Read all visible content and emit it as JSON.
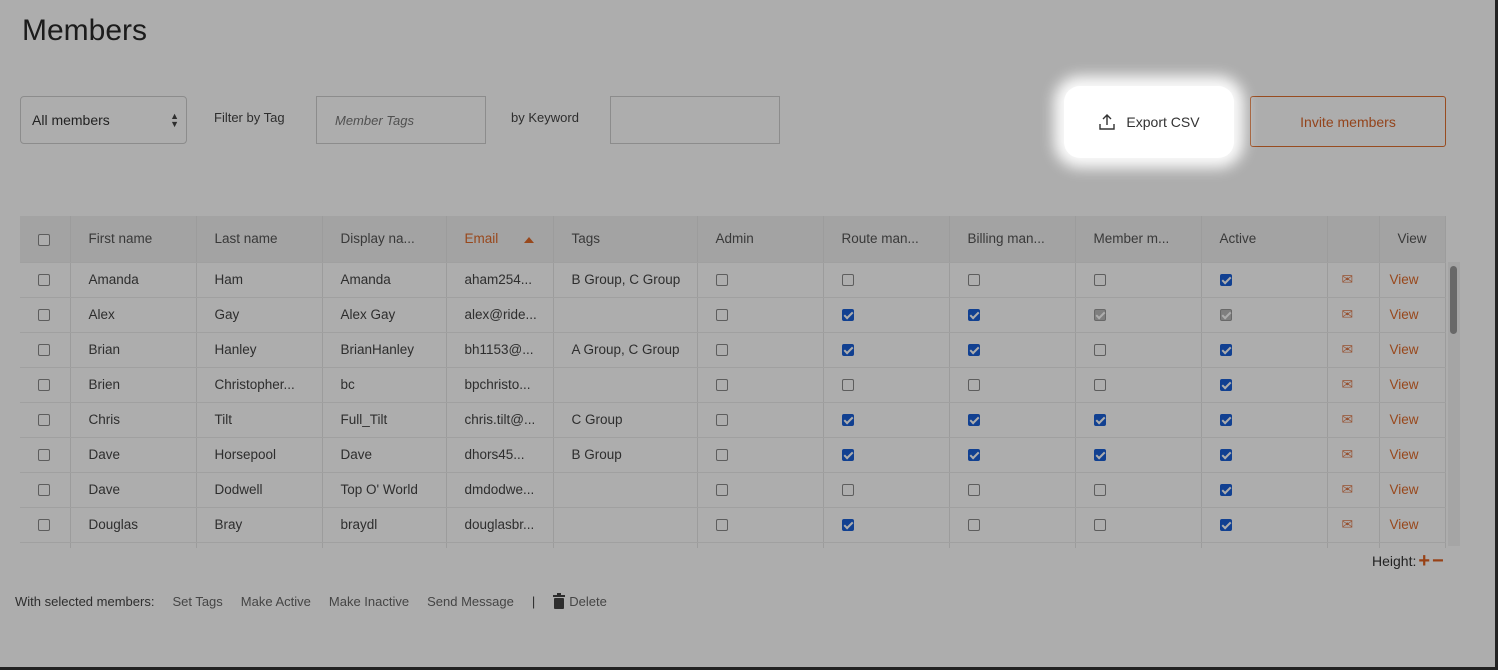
{
  "page": {
    "title": "Members"
  },
  "filters": {
    "member_select": "All members",
    "tag_label": "Filter by Tag",
    "tag_placeholder": "Member Tags",
    "keyword_label": "by Keyword",
    "keyword_value": ""
  },
  "actions": {
    "export_label": "Export CSV",
    "invite_label": "Invite members"
  },
  "table": {
    "headers": {
      "first": "First name",
      "last": "Last name",
      "display": "Display na...",
      "email": "Email",
      "tags": "Tags",
      "admin": "Admin",
      "route": "Route man...",
      "billing": "Billing man...",
      "member": "Member m...",
      "active": "Active",
      "view": "View"
    },
    "view_label": "View",
    "rows": [
      {
        "first": "Amanda",
        "last": "Ham",
        "display": "Amanda",
        "email": "aham254...",
        "tags": "B Group, C Group",
        "admin": "off",
        "route": "off",
        "billing": "off",
        "member": "off",
        "active": "on"
      },
      {
        "first": "Alex",
        "last": "Gay",
        "display": "Alex Gay",
        "email": "alex@ride...",
        "tags": "",
        "admin": "off",
        "route": "on",
        "billing": "on",
        "member": "disabled",
        "active": "disabled"
      },
      {
        "first": "Brian",
        "last": "Hanley",
        "display": "BrianHanley",
        "email": "bh1153@...",
        "tags": "A Group, C Group",
        "admin": "off",
        "route": "on",
        "billing": "on",
        "member": "off",
        "active": "on"
      },
      {
        "first": "Brien",
        "last": "Christopher...",
        "display": "bc",
        "email": "bpchristo...",
        "tags": "",
        "admin": "off",
        "route": "off",
        "billing": "off",
        "member": "off",
        "active": "on"
      },
      {
        "first": "Chris",
        "last": "Tilt",
        "display": "Full_Tilt",
        "email": "chris.tilt@...",
        "tags": "C Group",
        "admin": "off",
        "route": "on",
        "billing": "on",
        "member": "on",
        "active": "on"
      },
      {
        "first": "Dave",
        "last": "Horsepool",
        "display": "Dave",
        "email": "dhors45...",
        "tags": "B Group",
        "admin": "off",
        "route": "on",
        "billing": "on",
        "member": "on",
        "active": "on"
      },
      {
        "first": "Dave",
        "last": "Dodwell",
        "display": "Top O' World",
        "email": "dmdodwe...",
        "tags": "",
        "admin": "off",
        "route": "off",
        "billing": "off",
        "member": "off",
        "active": "on"
      },
      {
        "first": "Douglas",
        "last": "Bray",
        "display": "braydl",
        "email": "douglasbr...",
        "tags": "",
        "admin": "off",
        "route": "on",
        "billing": "off",
        "member": "off",
        "active": "on"
      },
      {
        "first": "",
        "last": "",
        "display": "",
        "email": "",
        "tags": "",
        "admin": "none",
        "route": "none",
        "billing": "none",
        "member": "none",
        "active": "none"
      }
    ]
  },
  "height_control": {
    "label": "Height:",
    "plus": "+",
    "minus": "−"
  },
  "bulk": {
    "label": "With selected members:",
    "set_tags": "Set Tags",
    "make_active": "Make Active",
    "make_inactive": "Make Inactive",
    "send_message": "Send Message",
    "separator": "|",
    "delete": "Delete"
  },
  "colors": {
    "accent": "#e06a2a",
    "checkbox_on": "#1a5fd6"
  },
  "icons": {
    "export": "upload-icon",
    "mail": "envelope-icon",
    "delete": "trash-icon",
    "sort": "sort-asc-icon"
  }
}
